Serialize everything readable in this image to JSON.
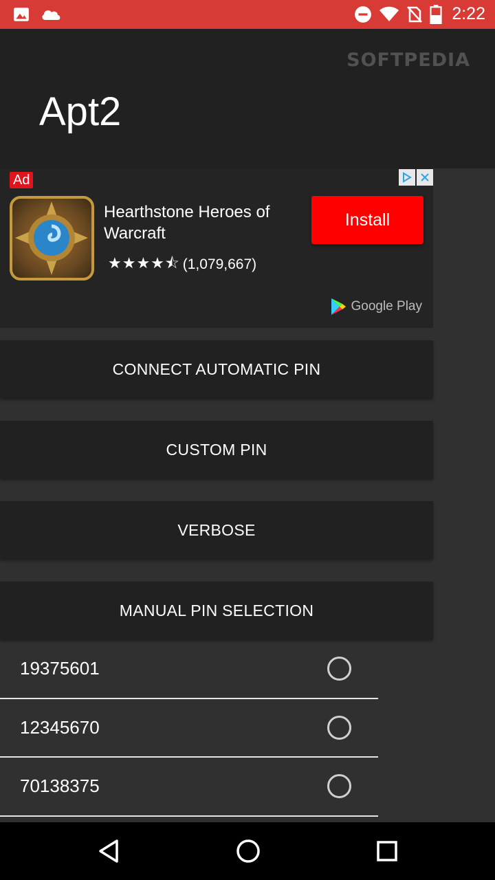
{
  "status_bar": {
    "time": "2:22",
    "left_icons": [
      "image-icon",
      "cloud-icon"
    ],
    "right_icons": [
      "do-not-disturb-icon",
      "wifi-icon",
      "no-sim-icon",
      "battery-icon"
    ],
    "background_color": "#d83b35"
  },
  "watermark": "SOFTPEDIA",
  "app_bar": {
    "title": "Apt2"
  },
  "ad": {
    "badge": "Ad",
    "app_name": "Hearthstone Heroes of Warcraft",
    "rating_stars": 4.5,
    "rating_count": "(1,079,667)",
    "install_label": "Install",
    "install_color": "#ff0000",
    "store_label": "Google Play"
  },
  "buttons": {
    "connect_automatic_pin": "CONNECT AUTOMATIC PIN",
    "custom_pin": "CUSTOM PIN",
    "verbose": "VERBOSE",
    "manual_pin_selection": "MANUAL PIN SELECTION"
  },
  "pins": [
    "19375601",
    "12345670",
    "70138375"
  ],
  "navigation": {
    "buttons": [
      "back-icon",
      "home-icon",
      "recents-icon"
    ]
  }
}
